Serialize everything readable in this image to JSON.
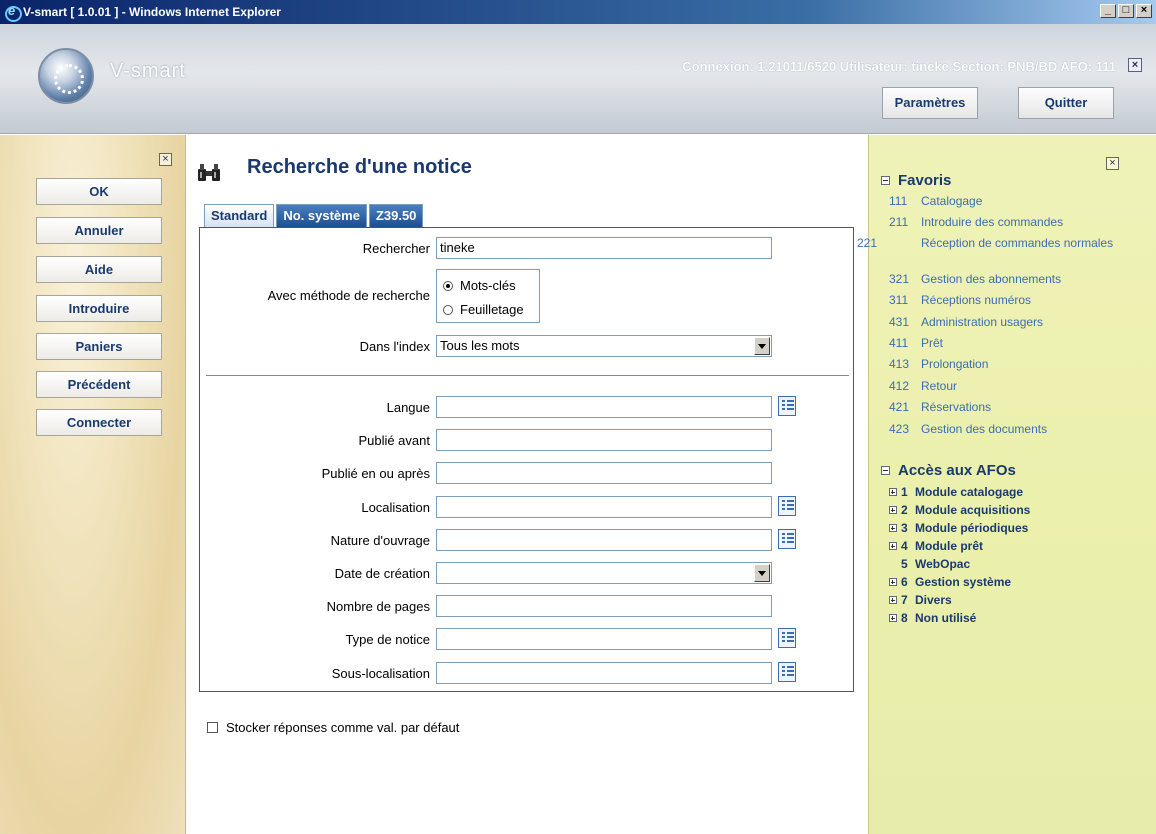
{
  "window": {
    "title": "V-smart [ 1.0.01 ] - Windows Internet Explorer"
  },
  "header": {
    "logo_text": "V-smart",
    "connection_info": "Connexion: 1.21011/6520   Utilisateur: tineke   Section: PNB/BD   AFO: 111",
    "params_label": "Paramètres",
    "quit_label": "Quitter"
  },
  "sidebar": {
    "buttons": [
      "OK",
      "Annuler",
      "Aide",
      "Introduire",
      "Paniers",
      "Précédent",
      "Connecter"
    ]
  },
  "main": {
    "title": "Recherche d'une notice",
    "tabs": [
      "Standard",
      "No. système",
      "Z39.50"
    ],
    "search_label": "Rechercher",
    "search_value": "tineke",
    "method_label": "Avec méthode de recherche",
    "method_options": [
      "Mots-clés",
      "Feuilletage"
    ],
    "index_label": "Dans l'index",
    "index_value": "Tous les mots",
    "langue_label": "Langue",
    "publie_avant_label": "Publié avant",
    "publie_apres_label": "Publié en ou après",
    "localisation_label": "Localisation",
    "nature_label": "Nature d'ouvrage",
    "date_creation_label": "Date de création",
    "nombre_pages_label": "Nombre de pages",
    "type_notice_label": "Type de notice",
    "sous_localisation_label": "Sous-localisation",
    "store_label": "Stocker réponses comme val. par défaut"
  },
  "right": {
    "favoris_title": "Favoris",
    "favoris": [
      {
        "num": "111",
        "label": "Catalogage"
      },
      {
        "num": "211",
        "label": "Introduire des commandes"
      },
      {
        "num": "221",
        "label": "Réception de commandes normales"
      },
      {
        "num": "321",
        "label": "Gestion des abonnements"
      },
      {
        "num": "311",
        "label": "Réceptions numéros"
      },
      {
        "num": "431",
        "label": "Administration usagers"
      },
      {
        "num": "411",
        "label": "Prêt"
      },
      {
        "num": "413",
        "label": "Prolongation"
      },
      {
        "num": "412",
        "label": "Retour"
      },
      {
        "num": "421",
        "label": "Réservations"
      },
      {
        "num": "423",
        "label": "Gestion des documents"
      }
    ],
    "afos_title": "Accès aux AFOs",
    "afos": [
      {
        "num": "1",
        "label": "Module catalogage"
      },
      {
        "num": "2",
        "label": "Module acquisitions"
      },
      {
        "num": "3",
        "label": "Module périodiques"
      },
      {
        "num": "4",
        "label": "Module prêt"
      },
      {
        "num": "5",
        "label": "WebOpac"
      },
      {
        "num": "6",
        "label": "Gestion système"
      },
      {
        "num": "7",
        "label": "Divers"
      },
      {
        "num": "8",
        "label": "Non utilisé"
      }
    ]
  }
}
